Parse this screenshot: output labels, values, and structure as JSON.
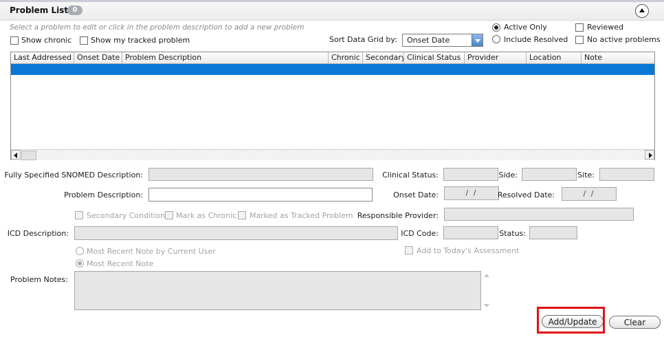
{
  "panel": {
    "title": "Problem List",
    "count": "0"
  },
  "hint": "Select a problem to edit or click in the problem description to add a new problem",
  "filters": {
    "show_chronic": "Show chronic",
    "show_tracked": "Show my tracked problem",
    "sort_label": "Sort Data Grid by:",
    "sort_value": "Onset Date",
    "active_only": "Active Only",
    "include_resolved": "Include Resolved",
    "reviewed": "Reviewed",
    "no_active": "No active problems"
  },
  "grid": {
    "columns": [
      "Last Addressed",
      "Onset Date",
      "Problem Description",
      "Chronic",
      "Secondary",
      "Clinical Status",
      "Provider",
      "Location",
      "Note"
    ]
  },
  "form": {
    "snomed_label": "Fully Specified SNOMED Description:",
    "clinical_status_label": "Clinical Status:",
    "side_label": "Side:",
    "site_label": "Site:",
    "problem_desc_label": "Problem Description:",
    "onset_date_label": "Onset Date:",
    "onset_date_value": "/ /",
    "resolved_date_label": "Resolved Date:",
    "resolved_date_value": "/ /",
    "secondary_condition": "Secondary Condition",
    "mark_chronic": "Mark as Chronic",
    "marked_tracked": "Marked as Tracked Problem",
    "responsible_provider_label": "Responsible Provider:",
    "icd_desc_label": "ICD Description:",
    "icd_code_label": "ICD Code:",
    "status_label": "Status:",
    "most_recent_user": "Most Recent Note by Current User",
    "add_today": "Add to Today's Assessment",
    "most_recent_note": "Most Recent Note",
    "problem_notes_label": "Problem Notes:"
  },
  "buttons": {
    "add_update": "Add/Update",
    "clear": "Clear"
  },
  "colors": {
    "selection": "#0a78d7",
    "highlight": "#e11212"
  }
}
